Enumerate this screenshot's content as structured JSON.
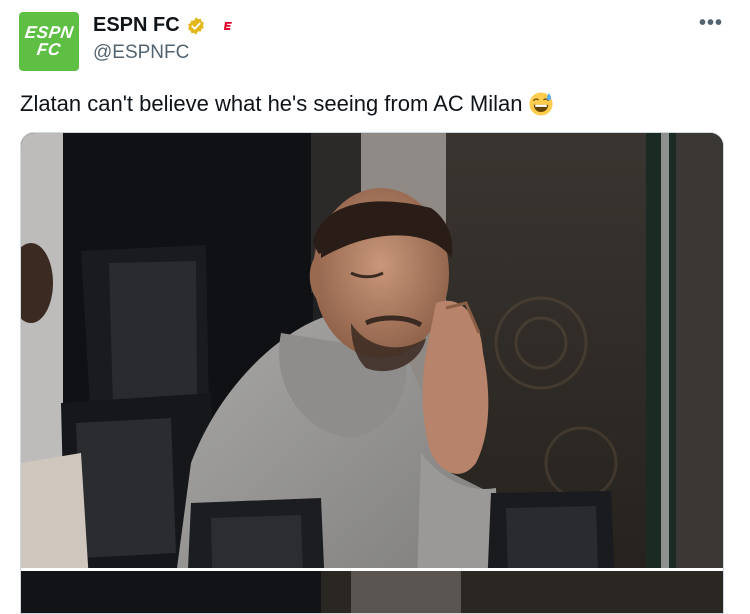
{
  "author": {
    "display_name": "ESPN FC",
    "handle": "@ESPNFC",
    "avatar_line1": "ESPN",
    "avatar_line2": "FC",
    "avatar_color": "#5fbf45",
    "verified_color": "#e2b719",
    "affiliate_color": "#e4002b"
  },
  "tweet": {
    "text": "Zlatan can't believe what he's seeing from AC Milan",
    "emoji": "grinning-sweat-emoji"
  },
  "more_label": "•••",
  "media": {
    "kind": "photo",
    "subject": "zlatan-photo"
  }
}
